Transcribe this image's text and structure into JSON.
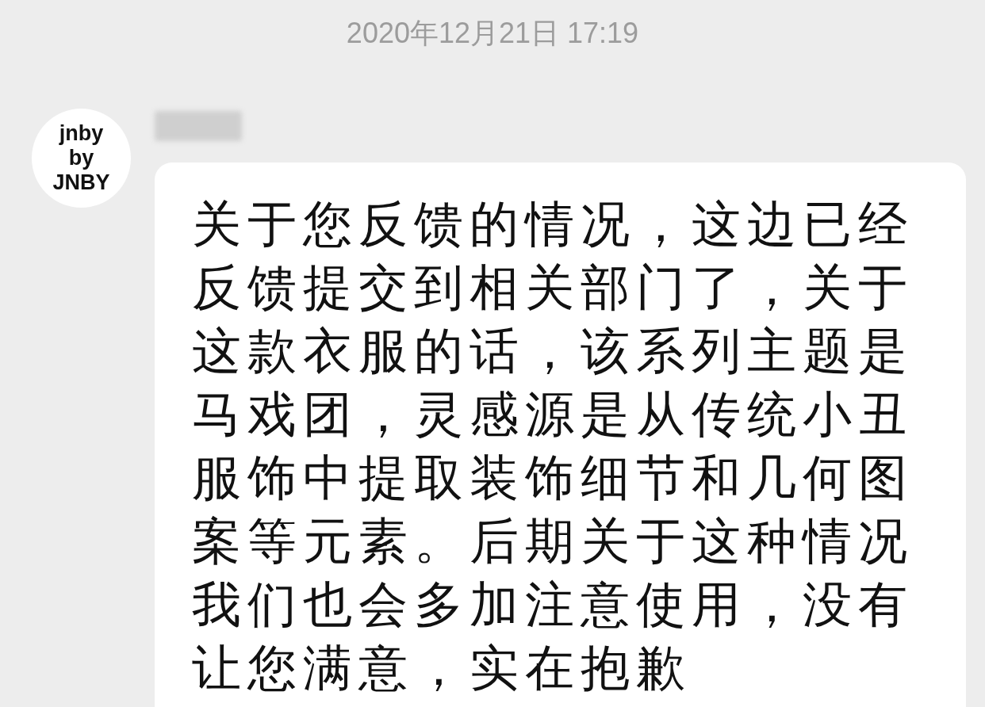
{
  "timestamp": "2020年12月21日 17:19",
  "messages": [
    {
      "avatar_lines": [
        "jnby",
        "by",
        "JNBY"
      ],
      "sender_blurred": true,
      "text": "关于您反馈的情况，这边已经反馈提交到相关部门了，关于这款衣服的话，该系列主题是马戏团，灵感源是从传统小丑服饰中提取装饰细节和几何图案等元素。后期关于这种情况我们也会多加注意使用，没有让您满意，实在抱歉"
    }
  ]
}
